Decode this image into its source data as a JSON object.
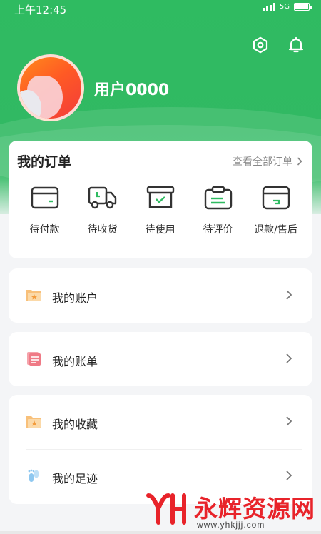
{
  "status_bar": {
    "time": "上午12:45",
    "network": "5G"
  },
  "header": {
    "username": "用户0000",
    "settings_icon": "settings-hex-icon",
    "bell_icon": "bell-icon"
  },
  "orders": {
    "title": "我的订单",
    "view_all": "查看全部订单",
    "items": [
      {
        "label": "待付款",
        "icon": "wallet-card-icon"
      },
      {
        "label": "待收货",
        "icon": "truck-icon"
      },
      {
        "label": "待使用",
        "icon": "box-check-icon"
      },
      {
        "label": "待评价",
        "icon": "clipboard-icon"
      },
      {
        "label": "退款/售后",
        "icon": "refund-box-icon"
      }
    ]
  },
  "menu": [
    {
      "label": "我的账户",
      "icon": "folder-star-icon"
    },
    {
      "label": "我的账单",
      "icon": "bill-icon"
    },
    {
      "label": "我的收藏",
      "icon": "folder-star-icon"
    },
    {
      "label": "我的足迹",
      "icon": "footprint-icon"
    }
  ],
  "watermark": {
    "text": "永辉资源网",
    "url": "www.yhkjjj.com"
  },
  "colors": {
    "brand_green": "#2fbb61",
    "icon_orange": "#f5a64a",
    "icon_pink": "#ef7a86",
    "icon_blue": "#8fc8f0",
    "watermark_red": "#e8232a"
  }
}
